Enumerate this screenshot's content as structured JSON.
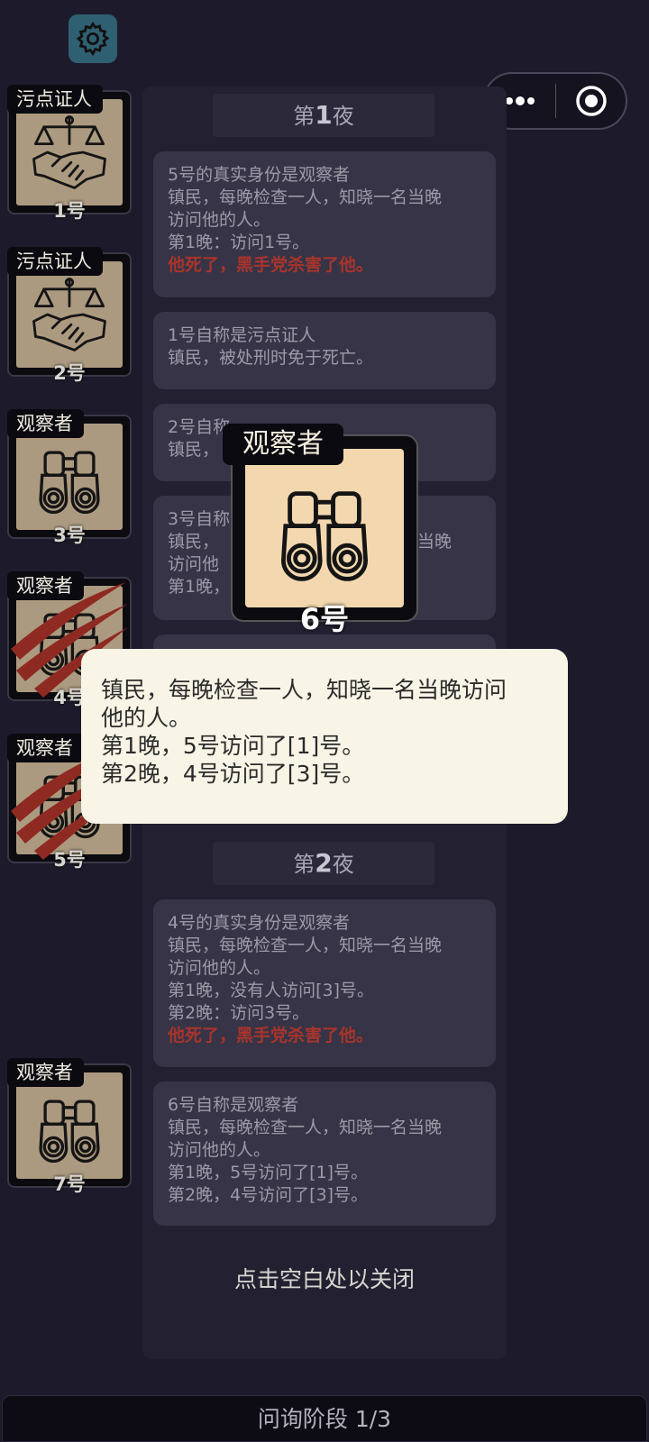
{
  "settings": {
    "icon": "gear-icon"
  },
  "capsule": {
    "more_icon": "more-dots-icon",
    "close_icon": "target-icon"
  },
  "players": [
    {
      "role": "污点证人",
      "number": "1号",
      "icon": "handshake-scales-icon",
      "dead": false
    },
    {
      "role": "污点证人",
      "number": "2号",
      "icon": "handshake-scales-icon",
      "dead": false
    },
    {
      "role": "观察者",
      "number": "3号",
      "icon": "binoculars-icon",
      "dead": false
    },
    {
      "role": "观察者",
      "number": "4号",
      "icon": "binoculars-icon",
      "dead": true
    },
    {
      "role": "观察者",
      "number": "5号",
      "icon": "binoculars-icon",
      "dead": true
    },
    {
      "role": "观察者",
      "number": "7号",
      "icon": "binoculars-icon",
      "dead": false
    }
  ],
  "log": {
    "night1": {
      "prefix": "第",
      "num": "1",
      "suffix": "夜"
    },
    "night2": {
      "prefix": "第",
      "num": "2",
      "suffix": "夜"
    },
    "entries": [
      {
        "lines": [
          "5号的真实身份是观察者",
          "镇民，每晚检查一人，知晓一名当晚",
          "访问他的人。",
          "第1晚：访问1号。"
        ],
        "death": "他死了，黑手党杀害了他。"
      },
      {
        "lines": [
          "1号自称是污点证人",
          "镇民，被处刑时免于死亡。"
        ],
        "death": ""
      },
      {
        "lines": [
          "2号自称",
          "镇民，"
        ],
        "death": ""
      },
      {
        "lines": [
          "3号自称",
          "镇民，",
          "访问他",
          "第1晚，"
        ],
        "death": "",
        "right": [
          "",
          "名当晚",
          "",
          ""
        ]
      },
      {
        "lines": [
          "4号的真实身份是观察者",
          "镇民，每晚检查一人，知晓一名当晚",
          "访问他的人。",
          "第1晚，没有人访问[3]号。",
          "第2晚：访问3号。"
        ],
        "death": "他死了，黑手党杀害了他。"
      },
      {
        "lines": [
          "6号自称是观察者",
          "镇民，每晚检查一人，知晓一名当晚",
          "访问他的人。",
          "第1晚，5号访问了[1]号。",
          "第2晚，4号访问了[3]号。"
        ],
        "death": ""
      }
    ],
    "close_hint": "点击空白处以关闭"
  },
  "overlay": {
    "role": "观察者",
    "number": "6号",
    "icon": "binoculars-icon",
    "tooltip_lines": [
      "镇民，每晚检查一人，知晓一名当晚访问",
      "他的人。",
      "第1晚，5号访问了[1]号。",
      "第2晚，4号访问了[3]号。"
    ]
  },
  "bottom_bar": {
    "label": "问询阶段 1/3"
  }
}
